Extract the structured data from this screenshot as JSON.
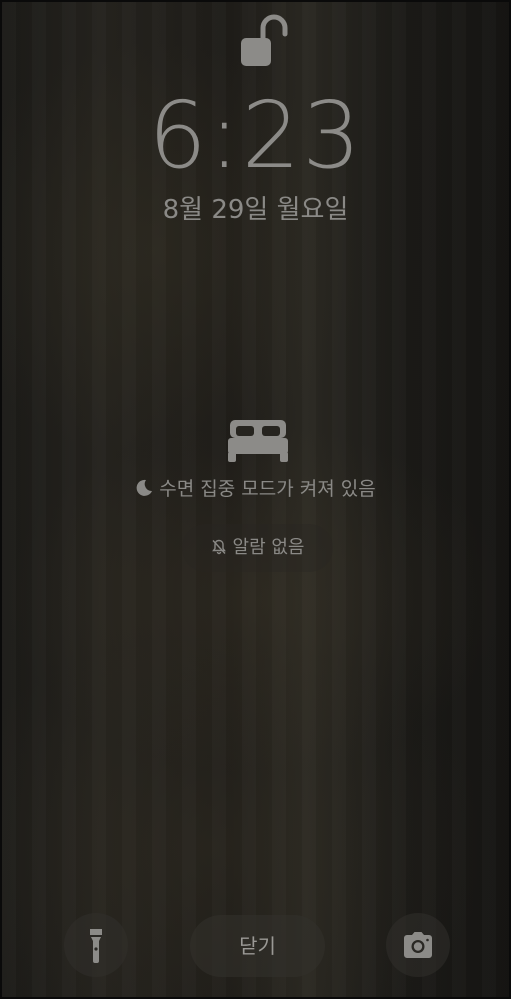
{
  "lock_screen": {
    "lock_icon": "unlocked-padlock-icon",
    "time": "6:23",
    "date": "8월 29일 월요일"
  },
  "sleep_focus": {
    "bed_icon": "bed-icon",
    "moon_icon": "moon-icon",
    "status_text": "수면 집중 모드가 켜져 있음",
    "alarm_icon": "bell-slash-icon",
    "alarm_text": "알람 없음"
  },
  "bottom_bar": {
    "flashlight_icon": "flashlight-icon",
    "close_label": "닫기",
    "camera_icon": "camera-icon"
  },
  "colors": {
    "text": "#8a8986",
    "background": "#1f1d19"
  }
}
